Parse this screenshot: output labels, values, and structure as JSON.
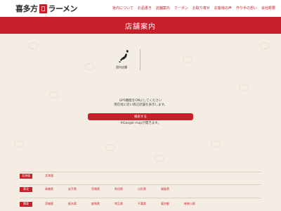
{
  "header": {
    "logo_text_1": "喜多方",
    "logo_text_2": "ラーメン",
    "nav": [
      {
        "label": "坂内について"
      },
      {
        "label": "お品書き"
      },
      {
        "label": "店舗案内"
      },
      {
        "label": "クーポン"
      },
      {
        "label": "お取り寄せ"
      },
      {
        "label": "お客様の声"
      },
      {
        "label": "作り手の想い"
      },
      {
        "label": "会社概要"
      }
    ]
  },
  "page_title": "店舗案内",
  "map_menu": {
    "label": "国内店舗"
  },
  "gps": {
    "line1": "GPS機能をONにしてください",
    "line2": "現在地に近い周辺店舗を表示します。",
    "button_label": "検索する",
    "note": "※Google mapが開きます。"
  },
  "regions": [
    {
      "label": "北海道",
      "prefs": [
        "北海道"
      ]
    },
    {
      "label": "東北",
      "prefs": [
        "青森県",
        "岩手県",
        "宮城県",
        "秋田県",
        "山形県",
        "福島県"
      ]
    },
    {
      "label": "関東",
      "prefs": [
        "茨城県",
        "栃木県",
        "群馬県",
        "埼玉県",
        "千葉県",
        "東京都",
        "神奈川県"
      ]
    }
  ],
  "colors": {
    "brand_red": "#c8202a",
    "background": "#f3ede3"
  }
}
